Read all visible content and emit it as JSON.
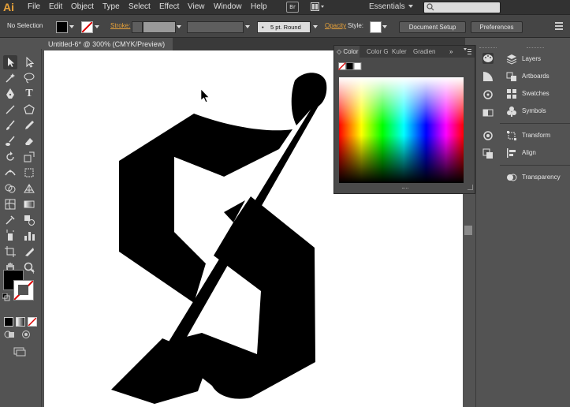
{
  "app": {
    "logo": "Ai"
  },
  "menu": [
    "File",
    "Edit",
    "Object",
    "Type",
    "Select",
    "Effect",
    "View",
    "Window",
    "Help"
  ],
  "bridge_label": "Br",
  "workspace": "Essentials",
  "control": {
    "selection": "No Selection",
    "stroke_label": "Stroke:",
    "brush": "5 pt. Round",
    "opacity_label": "Opacity",
    "style_label": "Style:",
    "doc_setup": "Document Setup",
    "preferences": "Preferences"
  },
  "document_tab": "Untitled-6* @ 300% (CMYK/Preview)",
  "color_panel": {
    "tabs": [
      "Color",
      "Color G",
      "Kuler",
      "Gradien"
    ]
  },
  "right_panel": [
    "Layers",
    "Artboards",
    "Swatches",
    "Symbols",
    "Transform",
    "Align",
    "Transparency"
  ],
  "colors": {
    "accent": "#e8a23a",
    "panel": "#535353",
    "menubar": "#323232"
  }
}
